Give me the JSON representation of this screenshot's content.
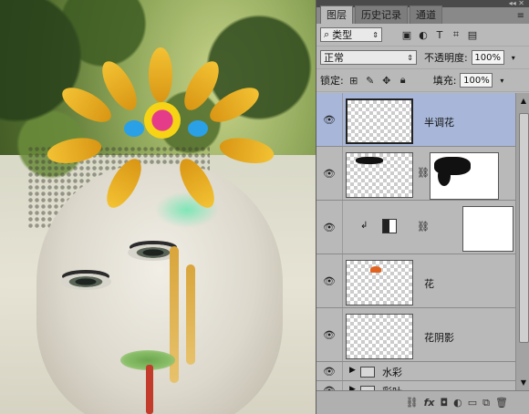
{
  "panel": {
    "tabs": [
      "图层",
      "历史记录",
      "通道"
    ],
    "top_icons": "◂◂  ✕",
    "menu_icon": "≡",
    "filter": {
      "label": "类型"
    },
    "blend_mode": "正常",
    "opacity": {
      "label": "不透明度:",
      "value": "100%"
    },
    "lock": {
      "label": "锁定:"
    },
    "fill": {
      "label": "填充:",
      "value": "100%"
    },
    "layers": [
      {
        "name": "半调花",
        "selected": true
      },
      {
        "name": "",
        "has_mask": true
      },
      {
        "name": "",
        "adjustment": true
      },
      {
        "name": "花"
      },
      {
        "name": "花阴影"
      }
    ],
    "groups": [
      {
        "name": "水彩"
      },
      {
        "name": "彩叶"
      }
    ]
  },
  "colors": {
    "selection": "#a8b7d9",
    "panel_bg": "#b9b9b9"
  }
}
